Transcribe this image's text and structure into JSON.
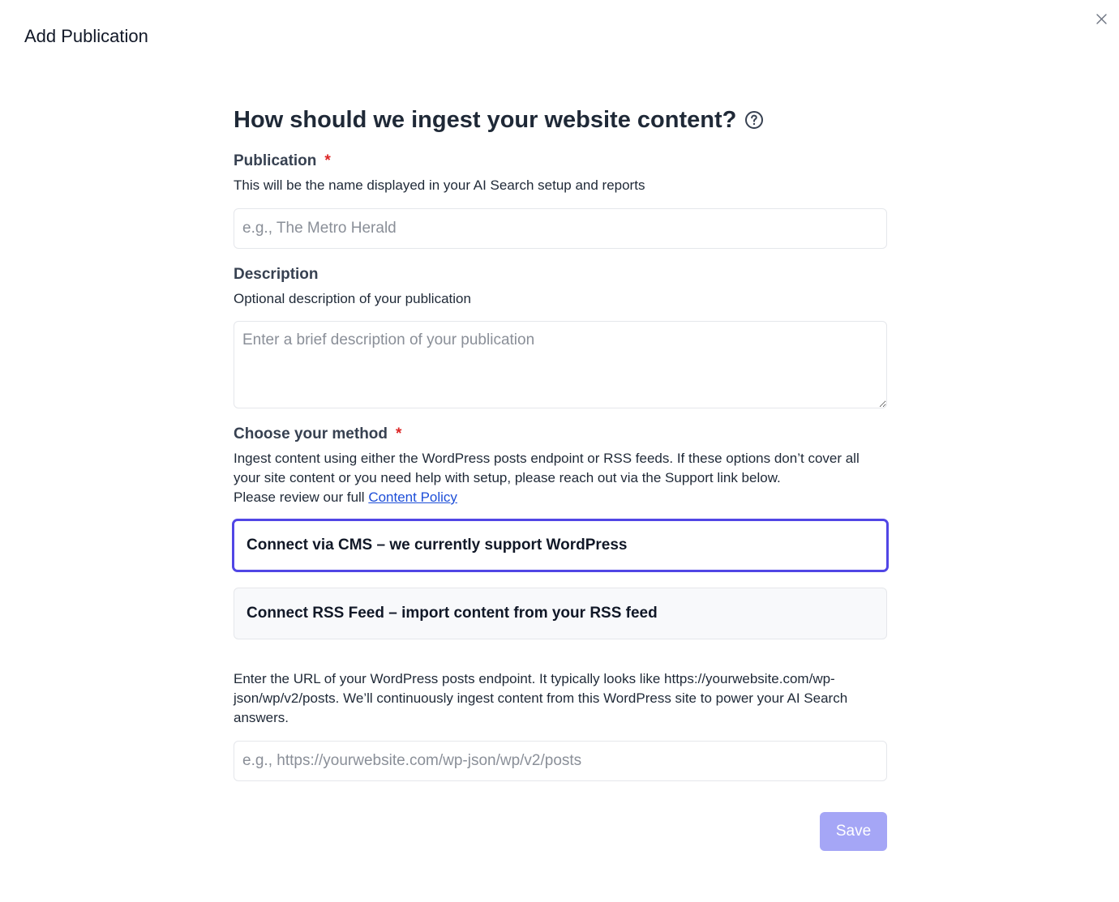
{
  "dialog": {
    "title": "Add Publication"
  },
  "form": {
    "heading": "How should we ingest your website content?",
    "publication": {
      "label": "Publication",
      "required_mark": "*",
      "hint": "This will be the name displayed in your AI Search setup and reports",
      "placeholder": "e.g., The Metro Herald",
      "value": ""
    },
    "description": {
      "label": "Description",
      "hint": "Optional description of your publication",
      "placeholder": "Enter a brief description of your publication",
      "value": ""
    },
    "method": {
      "label": "Choose your method",
      "required_mark": "*",
      "hint_line1": "Ingest content using either the WordPress posts endpoint or RSS feeds. If these options don’t cover all your site content or you need help with setup, please reach out via the Support link below.",
      "hint_review": "Please review our full",
      "policy_link": "Content Policy",
      "options": [
        {
          "label": "Connect via CMS – we currently support WordPress",
          "selected": true
        },
        {
          "label": "Connect RSS Feed – import content from your RSS feed",
          "selected": false
        }
      ]
    },
    "endpoint": {
      "hint": "Enter the URL of your WordPress posts endpoint. It typically looks like https://yourwebsite.com/wp-json/wp/v2/posts. We’ll continuously ingest content from this WordPress site to power your AI Search answers.",
      "placeholder": "e.g., https://yourwebsite.com/wp-json/wp/v2/posts",
      "value": ""
    },
    "save_label": "Save"
  },
  "colors": {
    "accent": "#5146e5",
    "save_button_disabled": "#a5a6f6",
    "required": "#dc2626",
    "link": "#1d4ed8"
  },
  "icons": {
    "close": "close-icon",
    "help": "help-circle-icon"
  }
}
